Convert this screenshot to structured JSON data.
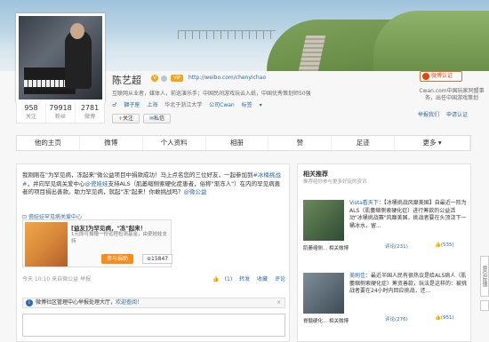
{
  "profile": {
    "name": "陈艺超",
    "url": "http://weibo.com/chenyichao",
    "vip_label": "VIP",
    "bio": "互联网从业者，媒体人，前巡演乐手；中国民间游戏玩云入纸，中国优秀策划师50强",
    "info": {
      "tag": "獅子座",
      "location": "上海",
      "school": "华北于浙江大学",
      "company": "公司Cwan",
      "label": "标签"
    },
    "stats": [
      {
        "value": "958",
        "label": "关注"
      },
      {
        "value": "79918",
        "label": "粉丝"
      },
      {
        "value": "2781",
        "label": "微博"
      }
    ],
    "follow_button": "关注",
    "message_button": "私信"
  },
  "auth": {
    "badge": "微博认证",
    "desc": "Cwan.com中国玩家同盟事务，出任中国游戏策划",
    "links": [
      "举报我们",
      "申请认证"
    ]
  },
  "tabs": [
    "他的主页",
    "微博",
    "个人资料",
    "相册",
    "赞",
    "足迹",
    "更多"
  ],
  "post": {
    "text_pre": "我刚刚在\"为罕见病，冻起来\"微公益项目中捐款成功！马上点名您的三位好友，一起参加到",
    "topic": "#冰桶挑战#",
    "text_mid": "，并向罕见病关爱中心",
    "mention": "@瓷娃娃",
    "text_post": "支持ALS（肌萎缩侧索硬化症患者，俗称\"渐冻人\"）在内的罕见病患者的项目捐出善款。助力罕见病，就起\"冻\"起来！你敢挑战吗？",
    "mention2": "@微公益",
    "tag": "瓷娃娃罕见病关爱中心",
    "campaign": {
      "title": "[益友]为罕见病，\"冻\"起来！",
      "sub": "1元即可捐赠一份远程检测基金，由瓷娃娃支持",
      "action": "参与捐助",
      "count": "15847"
    },
    "meta_time": "今天 10:10",
    "meta_from": "来自微公益",
    "meta_report": "举报",
    "actions": [
      "(1)",
      "转发",
      "收藏",
      "评论"
    ]
  },
  "notice": {
    "text": "微博社区管理中心举报处理大厅，",
    "link": "欢迎查阅！",
    "close": "×"
  },
  "side": {
    "title": "相关推荐",
    "subtitle": "推荐给你参与更多好玩的资讯",
    "items": [
      {
        "name": "Vista看天下",
        "text": "：【冰桶挑战风靡美国】自最近一阵为ALS（肌萎缩侧索硬化症）进行筹款的公益活动\"冰桶挑战赛\"风靡美国，挑战者要在头顶浇下一桶冰水，留...",
        "caption": "肌萎缩侧...",
        "caption2": "相关微博",
        "comments": "评论(231)",
        "likes": "(535)"
      },
      {
        "name": "美刷佳",
        "text": "：最近半国人民有很热议是给ALS病人（肌萎缩侧索硬化症）筹资善款，玩法是这样的：被挑战者要在24小时内回应挑战，还...",
        "caption": "脊髓硬化...",
        "caption2": "相关微博",
        "comments": "评论(276)",
        "likes": "(951)"
      }
    ]
  },
  "feedback_tab": "意见反馈"
}
